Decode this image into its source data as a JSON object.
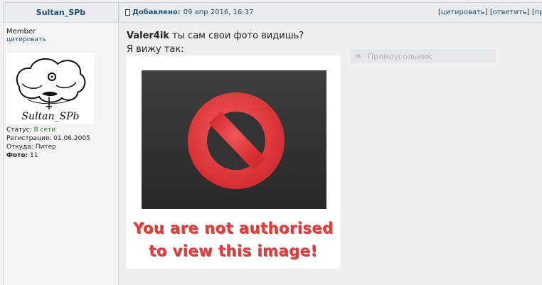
{
  "header": {
    "author_name": "Sultan_SPb",
    "added_label": "Добавлено:",
    "added_date": "09 апр 2016, 16:37",
    "actions": {
      "quote": "цитировать",
      "reply": "ответить",
      "more": "пр"
    }
  },
  "profile": {
    "rank": "Member",
    "quote_link": "цитировать",
    "avatar_signature": "Sultan_SPb",
    "status_label": "Статус:",
    "status_value": "В сети",
    "registration": "Регистрация: 01.06.2005",
    "location": "Откуда: Питер",
    "photo_label": "Фото:",
    "photo_count": "11"
  },
  "post": {
    "mention": "Valer4ik",
    "line1_rest": " ты сам свои фото видишь?",
    "line2": "Я вижу так:",
    "image_text_line1": "You are not authorised",
    "image_text_line2": "to view this image!"
  },
  "overlay": {
    "shape_label": "Прямоугольник"
  },
  "colors": {
    "link": "#1f4e79",
    "online": "#2a8a2a",
    "forbidden_red": "#e03a3a"
  }
}
